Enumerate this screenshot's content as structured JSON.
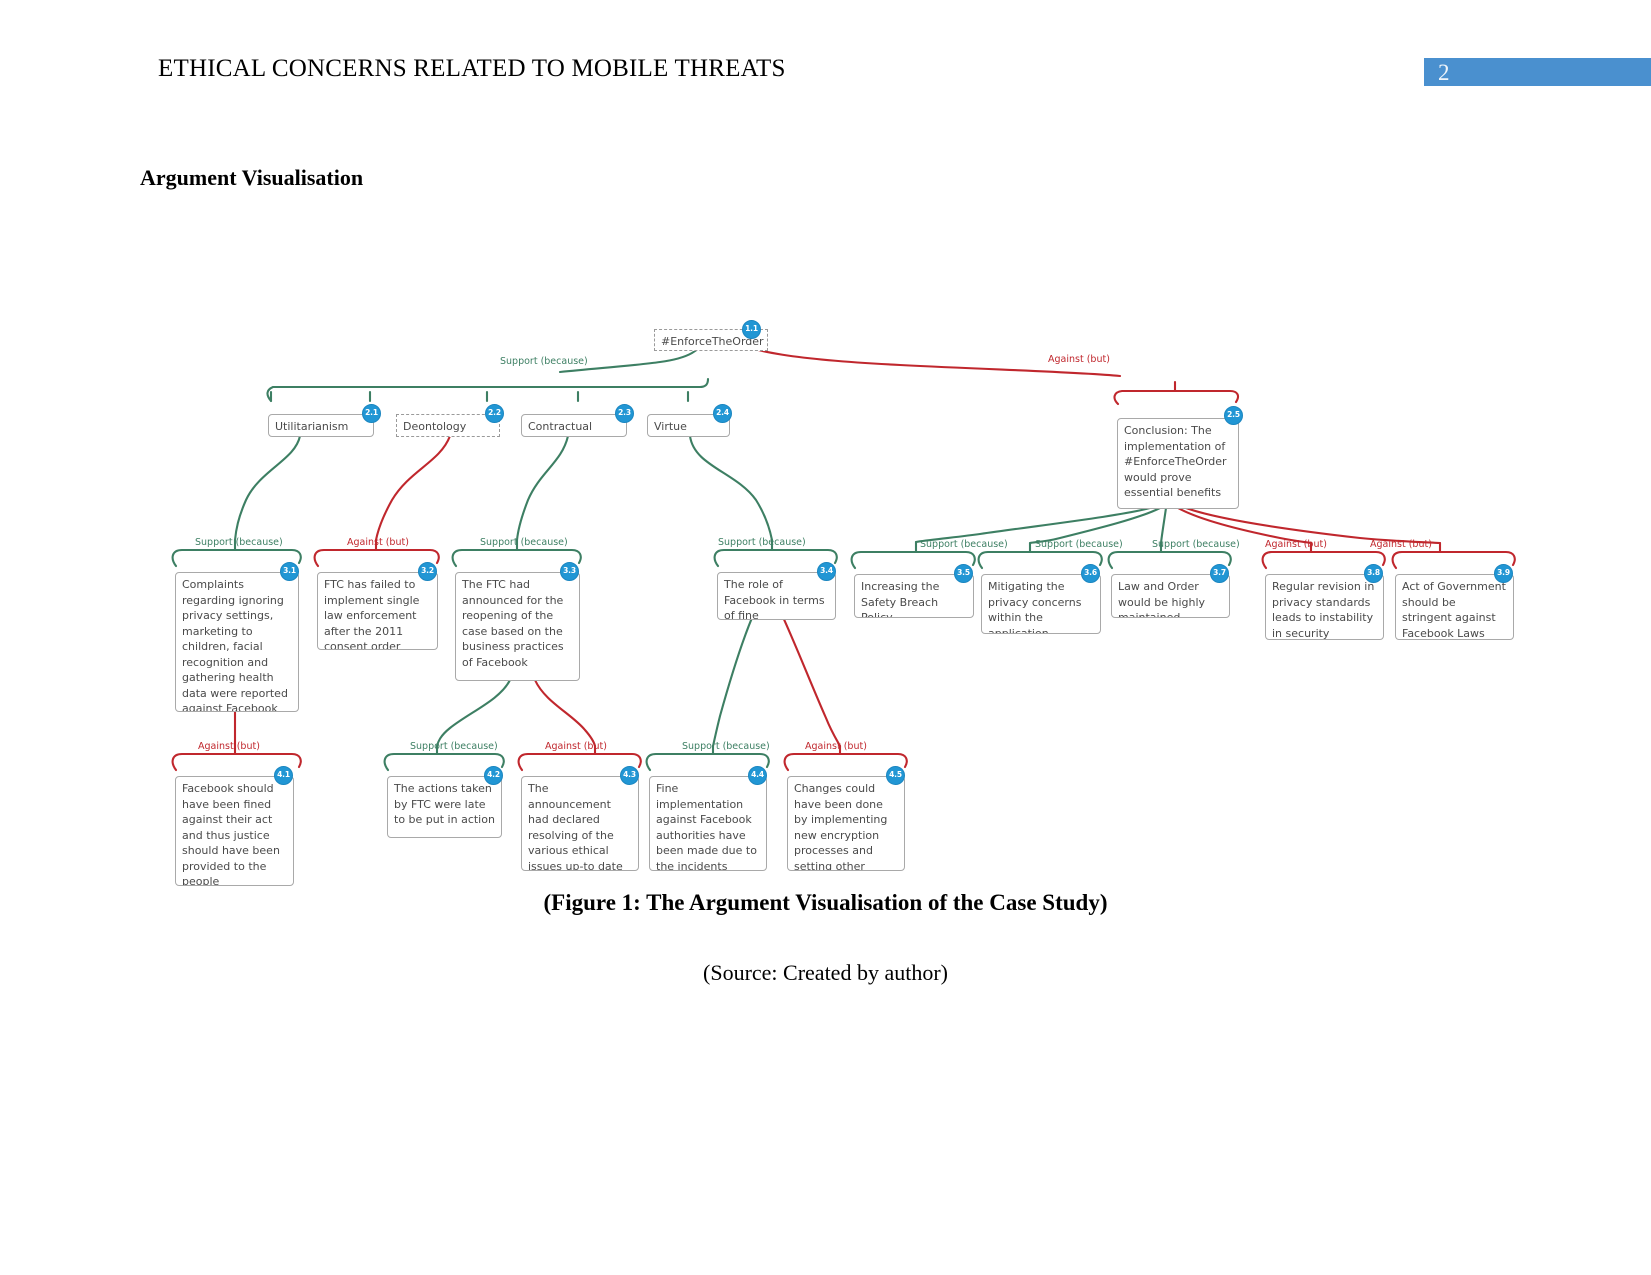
{
  "header": {
    "running_title": "ETHICAL CONCERNS RELATED TO MOBILE THREATS",
    "page_number": "2",
    "page_number_bg": "#4a90cf"
  },
  "section": {
    "title": "Argument Visualisation"
  },
  "figure": {
    "caption": "(Figure 1: The Argument Visualisation of the Case Study)",
    "source": "(Source: Created by author)"
  },
  "diagram": {
    "colors": {
      "support": "#3d7f63",
      "against": "#c0272d",
      "badge": "#2196d4",
      "node_border": "#a9a9a9",
      "node_text": "#4a4a4a"
    },
    "nodes": [
      {
        "id": "1.1",
        "badge": "1.1",
        "text": "#EnforceTheOrder",
        "style": "dashed"
      },
      {
        "id": "2.1",
        "badge": "2.1",
        "text": "Utilitarianism Theory",
        "style": "solid"
      },
      {
        "id": "2.2",
        "badge": "2.2",
        "text": "Deontology Theory",
        "style": "dashed"
      },
      {
        "id": "2.3",
        "badge": "2.3",
        "text": "Contractual Theory",
        "style": "solid"
      },
      {
        "id": "2.4",
        "badge": "2.4",
        "text": "Virtue Theory",
        "style": "solid"
      },
      {
        "id": "2.5",
        "badge": "2.5",
        "text": "Conclusion: The implementation of #EnforceTheOrder would prove essential benefits",
        "style": "solid"
      },
      {
        "id": "3.1",
        "badge": "3.1",
        "text": "Complaints regarding ignoring privacy settings, marketing to children, facial recognition and gathering health data were reported against Facebook",
        "style": "solid"
      },
      {
        "id": "3.2",
        "badge": "3.2",
        "text": "FTC has failed to implement single law enforcement after the 2011 consent order",
        "style": "solid"
      },
      {
        "id": "3.3",
        "badge": "3.3",
        "text": "The FTC had announced for the reopening of the case based on the business practices of Facebook",
        "style": "solid"
      },
      {
        "id": "3.4",
        "badge": "3.4",
        "text": "The role of Facebook in terms of fine imposement",
        "style": "solid"
      },
      {
        "id": "3.5",
        "badge": "3.5",
        "text": "Increasing the Safety Breach Policy",
        "style": "solid"
      },
      {
        "id": "3.6",
        "badge": "3.6",
        "text": "Mitigating the privacy concerns within the application",
        "style": "solid"
      },
      {
        "id": "3.7",
        "badge": "3.7",
        "text": "Law and Order would be highly maintained",
        "style": "solid"
      },
      {
        "id": "3.8",
        "badge": "3.8",
        "text": "Regular revision in privacy standards leads to instability in security platforms",
        "style": "solid"
      },
      {
        "id": "3.9",
        "badge": "3.9",
        "text": "Act of Government should be stringent against Facebook Laws",
        "style": "solid"
      },
      {
        "id": "4.1",
        "badge": "4.1",
        "text": "Facebook should have been fined against their act and thus justice should have been provided to the people",
        "style": "solid"
      },
      {
        "id": "4.2",
        "badge": "4.2",
        "text": "The actions taken by FTC were late to be put in action",
        "style": "solid"
      },
      {
        "id": "4.3",
        "badge": "4.3",
        "text": "The announcement had declared resolving of the various ethical issues up-to date",
        "style": "solid"
      },
      {
        "id": "4.4",
        "badge": "4.4",
        "text": "Fine implementation against Facebook authorities have been made due to the incidents",
        "style": "solid"
      },
      {
        "id": "4.5",
        "badge": "4.5",
        "text": "Changes could have been done by implementing new encryption processes and setting other",
        "style": "solid"
      }
    ],
    "edge_labels": {
      "support": "Support (because)",
      "against": "Against (but)"
    },
    "edges": [
      {
        "from": "2.1",
        "to": "1.1",
        "type": "support",
        "label": "Support (because)"
      },
      {
        "from": "2.2",
        "to": "1.1",
        "type": "support",
        "label": "Support (because)"
      },
      {
        "from": "2.3",
        "to": "1.1",
        "type": "support",
        "label": "Support (because)"
      },
      {
        "from": "2.4",
        "to": "1.1",
        "type": "support",
        "label": "Support (because)"
      },
      {
        "from": "2.5",
        "to": "1.1",
        "type": "against",
        "label": "Against (but)"
      },
      {
        "from": "3.1",
        "to": "2.1",
        "type": "support",
        "label": "Support (because)"
      },
      {
        "from": "3.2",
        "to": "2.2",
        "type": "against",
        "label": "Against (but)"
      },
      {
        "from": "3.3",
        "to": "2.3",
        "type": "support",
        "label": "Support (because)"
      },
      {
        "from": "3.4",
        "to": "2.4",
        "type": "support",
        "label": "Support (because)"
      },
      {
        "from": "3.5",
        "to": "2.5",
        "type": "support",
        "label": "Support (because)"
      },
      {
        "from": "3.6",
        "to": "2.5",
        "type": "support",
        "label": "Support (because)"
      },
      {
        "from": "3.7",
        "to": "2.5",
        "type": "support",
        "label": "Support (because)"
      },
      {
        "from": "3.8",
        "to": "2.5",
        "type": "against",
        "label": "Against (but)"
      },
      {
        "from": "3.9",
        "to": "2.5",
        "type": "against",
        "label": "Against (but)"
      },
      {
        "from": "4.1",
        "to": "3.1",
        "type": "against",
        "label": "Against (but)"
      },
      {
        "from": "4.2",
        "to": "3.3",
        "type": "support",
        "label": "Support (because)"
      },
      {
        "from": "4.3",
        "to": "3.3",
        "type": "against",
        "label": "Against (but)"
      },
      {
        "from": "4.4",
        "to": "3.4",
        "type": "support",
        "label": "Support (because)"
      },
      {
        "from": "4.5",
        "to": "3.4",
        "type": "against",
        "label": "Against (but)"
      }
    ]
  }
}
